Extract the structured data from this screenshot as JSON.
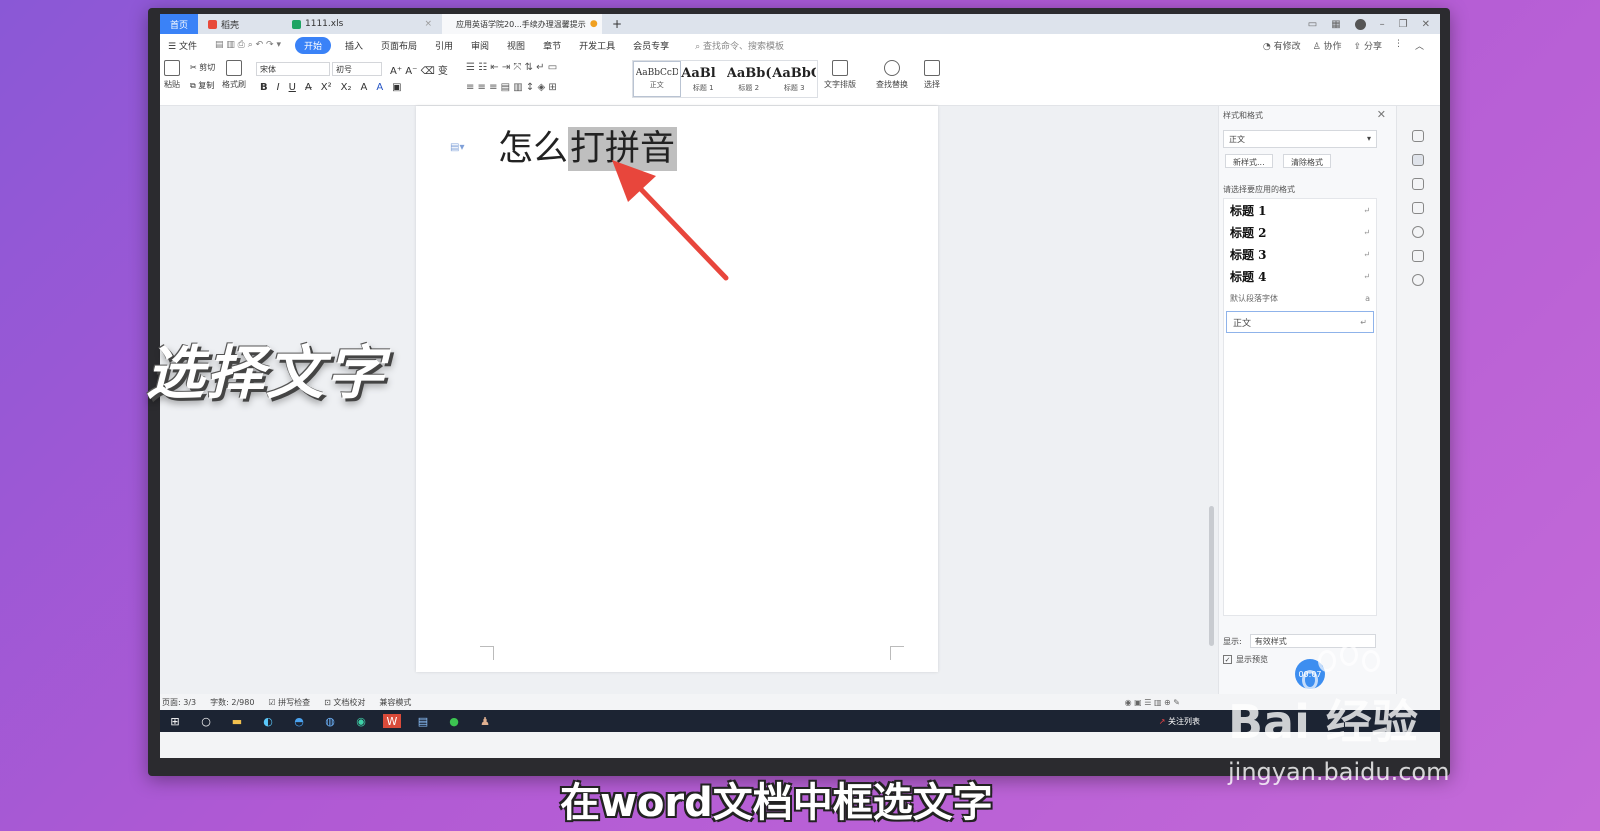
{
  "tabs": {
    "home": "首页",
    "shell": "稻壳",
    "xls": "1111.xls",
    "doc": "应用英语学院20...手续办理温馨提示",
    "add": "+"
  },
  "menu": {
    "file": "文件",
    "start": "开始",
    "insert": "插入",
    "layout": "页面布局",
    "refs": "引用",
    "review": "审阅",
    "view": "视图",
    "chapter": "章节",
    "devtools": "开发工具",
    "member": "会员专享",
    "search": "查找命令、搜索模板",
    "modified": "有修改",
    "collab": "协作",
    "share": "分享"
  },
  "ribbon": {
    "paste": "粘贴",
    "cut": "剪切",
    "copy": "复制",
    "format_painter": "格式刷",
    "font_name": "宋体",
    "font_size": "初号",
    "styles": [
      {
        "preview": "AaBbCcDd",
        "label": "正文"
      },
      {
        "preview": "AaBl",
        "label": "标题 1"
      },
      {
        "preview": "AaBb(",
        "label": "标题 2"
      },
      {
        "preview": "AaBbC",
        "label": "标题 3"
      }
    ],
    "text_layout": "文字排版",
    "find_replace": "查找替换",
    "select": "选择"
  },
  "document": {
    "text_before": "怎么",
    "text_selected": "打拼音"
  },
  "panel": {
    "title": "样式和格式",
    "current_style": "正文",
    "new_style": "新样式...",
    "clear_format": "清除格式",
    "choose_label": "请选择要应用的格式",
    "styles": [
      "标题 1",
      "标题 2",
      "标题 3",
      "标题 4"
    ],
    "default_font": "默认段落字体",
    "normal": "正文",
    "show_label": "显示:",
    "show_value": "有效样式",
    "preview_label": "显示预览"
  },
  "timer": "00:07",
  "status": {
    "page": "页面: 3/3",
    "words": "字数: 2/980",
    "spellcheck": "拼写检查",
    "proofread": "文档校对",
    "compat": "兼容模式"
  },
  "taskbar": {
    "focus_list": "关注列表"
  },
  "overlay": {
    "step": "选择文字",
    "caption": "在word文档中框选文字",
    "watermark": "Bai 经验",
    "url": "jingyan.baidu.com"
  }
}
